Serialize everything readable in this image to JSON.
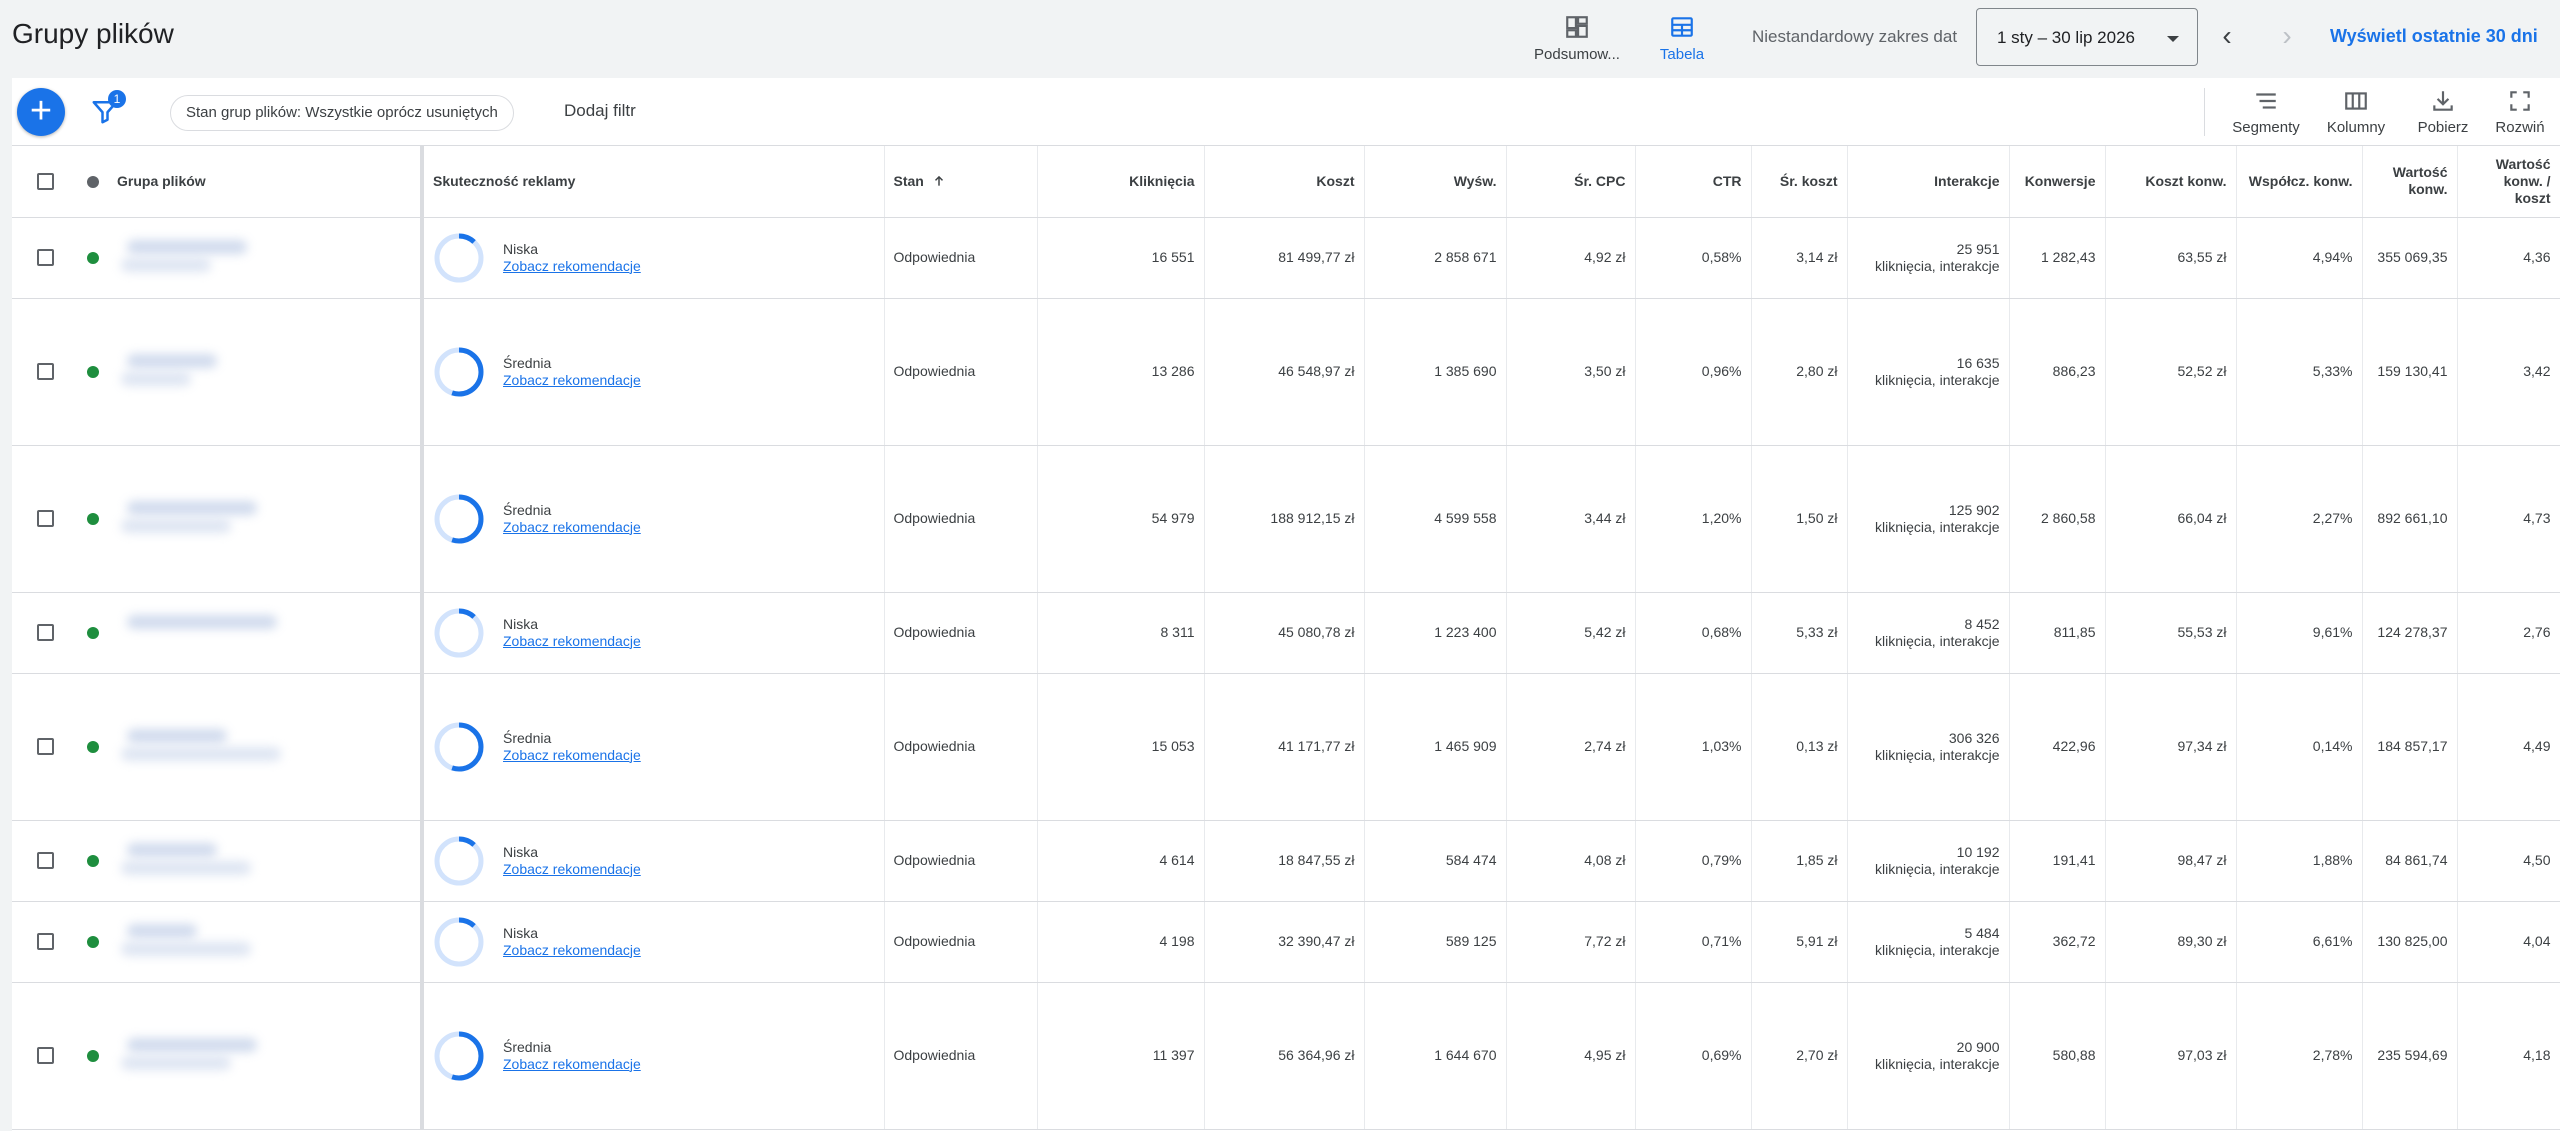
{
  "header": {
    "title": "Grupy plików",
    "view_summary": "Podsumow...",
    "view_table": "Tabela",
    "date_label": "Niestandardowy zakres dat",
    "date_value": "1 sty – 30 lip 2026",
    "prev_arrow": "‹",
    "next_arrow": "›",
    "last30": "Wyświetl ostatnie 30 dni"
  },
  "toolbar": {
    "add": "+",
    "filter_count": "1",
    "chip": "Stan grup plików: Wszystkie oprócz usuniętych",
    "add_filter": "Dodaj filtr",
    "segments": "Segmenty",
    "columns": "Kolumny",
    "download": "Pobierz",
    "expand": "Rozwiń"
  },
  "columns": {
    "group": "Grupa plików",
    "performance": "Skuteczność reklamy",
    "status": "Stan",
    "clicks": "Kliknięcia",
    "cost": "Koszt",
    "impressions": "Wyśw.",
    "avg_cpc": "Śr. CPC",
    "ctr": "CTR",
    "avg_cost": "Śr. koszt",
    "interactions": "Interakcje",
    "conversions": "Konwersje",
    "cost_conv": "Koszt konw.",
    "conv_rate": "Współcz. konw.",
    "conv_value": "Wartość konw.",
    "value_cost": "Wartość konw. / koszt"
  },
  "rows": [
    {
      "perf": "Niska",
      "rec": "Zobacz rekomendacje",
      "status": "Odpowiednia",
      "clicks": "16 551",
      "cost": "81 499,77 zł",
      "impr": "2 858 671",
      "cpc": "4,92 zł",
      "ctr": "0,58%",
      "avg_cost": "3,14 zł",
      "inter_n": "25 951",
      "inter_t": "kliknięcia, interakcje",
      "conv": "1 282,43",
      "cost_conv": "63,55 zł",
      "conv_rate": "4,94%",
      "conv_value": "355 069,35",
      "value_cost": "4,36"
    },
    {
      "perf": "Średnia",
      "rec": "Zobacz rekomendacje",
      "status": "Odpowiednia",
      "clicks": "13 286",
      "cost": "46 548,97 zł",
      "impr": "1 385 690",
      "cpc": "3,50 zł",
      "ctr": "0,96%",
      "avg_cost": "2,80 zł",
      "inter_n": "16 635",
      "inter_t": "kliknięcia, interakcje",
      "conv": "886,23",
      "cost_conv": "52,52 zł",
      "conv_rate": "5,33%",
      "conv_value": "159 130,41",
      "value_cost": "3,42"
    },
    {
      "perf": "Średnia",
      "rec": "Zobacz rekomendacje",
      "status": "Odpowiednia",
      "clicks": "54 979",
      "cost": "188 912,15 zł",
      "impr": "4 599 558",
      "cpc": "3,44 zł",
      "ctr": "1,20%",
      "avg_cost": "1,50 zł",
      "inter_n": "125 902",
      "inter_t": "kliknięcia, interakcje",
      "conv": "2 860,58",
      "cost_conv": "66,04 zł",
      "conv_rate": "2,27%",
      "conv_value": "892 661,10",
      "value_cost": "4,73"
    },
    {
      "perf": "Niska",
      "rec": "Zobacz rekomendacje",
      "status": "Odpowiednia",
      "clicks": "8 311",
      "cost": "45 080,78 zł",
      "impr": "1 223 400",
      "cpc": "5,42 zł",
      "ctr": "0,68%",
      "avg_cost": "5,33 zł",
      "inter_n": "8 452",
      "inter_t": "kliknięcia, interakcje",
      "conv": "811,85",
      "cost_conv": "55,53 zł",
      "conv_rate": "9,61%",
      "conv_value": "124 278,37",
      "value_cost": "2,76"
    },
    {
      "perf": "Średnia",
      "rec": "Zobacz rekomendacje",
      "status": "Odpowiednia",
      "clicks": "15 053",
      "cost": "41 171,77 zł",
      "impr": "1 465 909",
      "cpc": "2,74 zł",
      "ctr": "1,03%",
      "avg_cost": "0,13 zł",
      "inter_n": "306 326",
      "inter_t": "kliknięcia, interakcje",
      "conv": "422,96",
      "cost_conv": "97,34 zł",
      "conv_rate": "0,14%",
      "conv_value": "184 857,17",
      "value_cost": "4,49"
    },
    {
      "perf": "Niska",
      "rec": "Zobacz rekomendacje",
      "status": "Odpowiednia",
      "clicks": "4 614",
      "cost": "18 847,55 zł",
      "impr": "584 474",
      "cpc": "4,08 zł",
      "ctr": "0,79%",
      "avg_cost": "1,85 zł",
      "inter_n": "10 192",
      "inter_t": "kliknięcia, interakcje",
      "conv": "191,41",
      "cost_conv": "98,47 zł",
      "conv_rate": "1,88%",
      "conv_value": "84 861,74",
      "value_cost": "4,50"
    },
    {
      "perf": "Niska",
      "rec": "Zobacz rekomendacje",
      "status": "Odpowiednia",
      "clicks": "4 198",
      "cost": "32 390,47 zł",
      "impr": "589 125",
      "cpc": "7,72 zł",
      "ctr": "0,71%",
      "avg_cost": "5,91 zł",
      "inter_n": "5 484",
      "inter_t": "kliknięcia, interakcje",
      "conv": "362,72",
      "cost_conv": "89,30 zł",
      "conv_rate": "6,61%",
      "conv_value": "130 825,00",
      "value_cost": "4,04"
    },
    {
      "perf": "Średnia",
      "rec": "Zobacz rekomendacje",
      "status": "Odpowiednia",
      "clicks": "11 397",
      "cost": "56 364,96 zł",
      "impr": "1 644 670",
      "cpc": "4,95 zł",
      "ctr": "0,69%",
      "avg_cost": "2,70 zł",
      "inter_n": "20 900",
      "inter_t": "kliknięcia, interakcje",
      "conv": "580,88",
      "cost_conv": "97,03 zł",
      "conv_rate": "2,78%",
      "conv_value": "235 594,69",
      "value_cost": "4,18"
    }
  ],
  "colors": {
    "accent": "#1a73e8",
    "status_green": "#1e8e3e",
    "ring_track": "#d2e3fc"
  }
}
